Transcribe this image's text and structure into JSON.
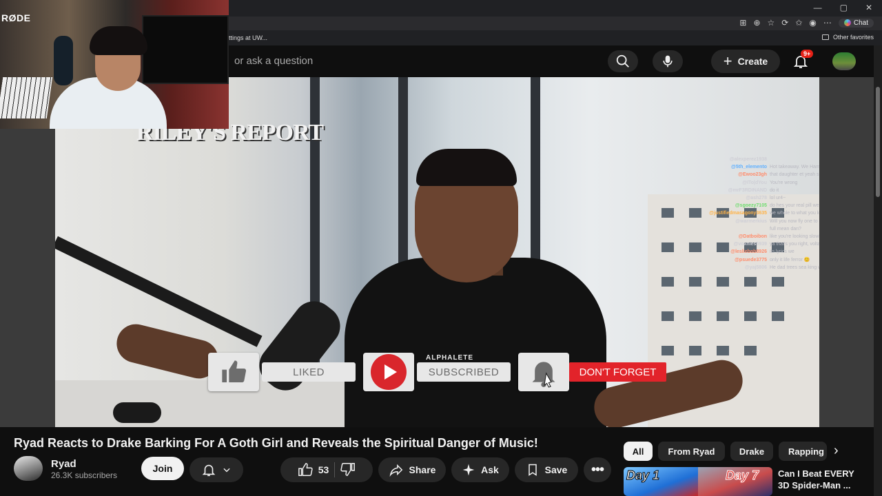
{
  "browser": {
    "tab_partial": "ttings at UW...",
    "bookmark_other": "Other favorites",
    "chat_label": "Chat",
    "window_controls": [
      "—",
      "▢",
      "✕"
    ]
  },
  "header": {
    "search_placeholder": "or ask a question",
    "create_label": "Create",
    "notification_badge": "9+"
  },
  "webcam": {
    "brand": "RØDE"
  },
  "video": {
    "sign_text": "RILEY'S REPORT",
    "shirt_text": "ALPHALETE",
    "chat": [
      {
        "user": "@alexperez1938",
        "msg": "",
        "color": "#cfcfd6"
      },
      {
        "user": "@5th_elemento",
        "msg": "Hot takeaway. We Hammers yourself...",
        "color": "#5fb0ff"
      },
      {
        "user": "@Ewoo23gh",
        "msg": "that daughter et yeah spe ravahhe fe sets",
        "color": "#ff8c6b"
      },
      {
        "user": "@ITo|dYou",
        "msg": "You're wrong",
        "color": "#cfcfd6"
      },
      {
        "user": "@mrF3RDINAND",
        "msg": "do it",
        "color": "#cfcfd6"
      },
      {
        "user": "@ash278",
        "msg": "lol ur4~",
        "color": "#cfcfd6"
      },
      {
        "user": "@sgoezy7105",
        "msg": "do hes your real pill were always great",
        "color": "#6fdc6f"
      },
      {
        "user": "@justifiedmasagony3635",
        "msg": "we whole to what you know doing",
        "color": "#ffb347"
      },
      {
        "user": "@warmerkius",
        "msg": "Will you now fly one to rescue and do a silent",
        "color": "#cfcfd6"
      },
      {
        "user": "",
        "msg": "full mean dan?",
        "color": "#cfcfd6"
      },
      {
        "user": "@Datboibon",
        "msg": "like you're looking slowly. I hope it is",
        "color": "#ff8c6b"
      },
      {
        "user": "@voxnies5939",
        "msg": "ya that's you right, voltage",
        "color": "#cfcfd6"
      },
      {
        "user": "@lesliebob8926",
        "msg": "its lyrics we",
        "color": "#ff8c6b"
      },
      {
        "user": "@psuede3775",
        "msg": "only it life ferror 😊",
        "color": "#ff8c6b"
      },
      {
        "user": "@yaj5806",
        "msg": "He dad trees sea king wav",
        "color": "#cfcfd6"
      }
    ],
    "overlay": {
      "liked": "LIKED",
      "subscribed": "SUBSCRIBED",
      "dont_forget": "DON'T FORGET"
    }
  },
  "details": {
    "title": "Ryad Reacts to Drake Barking For A Goth Girl and Reveals the Spiritual Danger of Music!",
    "channel_name": "Ryad",
    "subscribers": "26.3K subscribers",
    "join_label": "Join",
    "like_count": "53",
    "share_label": "Share",
    "ask_label": "Ask",
    "save_label": "Save"
  },
  "recommendations": {
    "chips": [
      "All",
      "From Ryad",
      "Drake",
      "Rapping"
    ],
    "active_chip": "All",
    "first": {
      "thumb_left_text": "Day 1",
      "thumb_right_text": "Day 7",
      "title": "Can I Beat EVERY 3D Spider-Man ..."
    }
  },
  "colors": {
    "accent_red": "#e2232a",
    "background": "#0f0f0f",
    "pill": "#272727"
  }
}
